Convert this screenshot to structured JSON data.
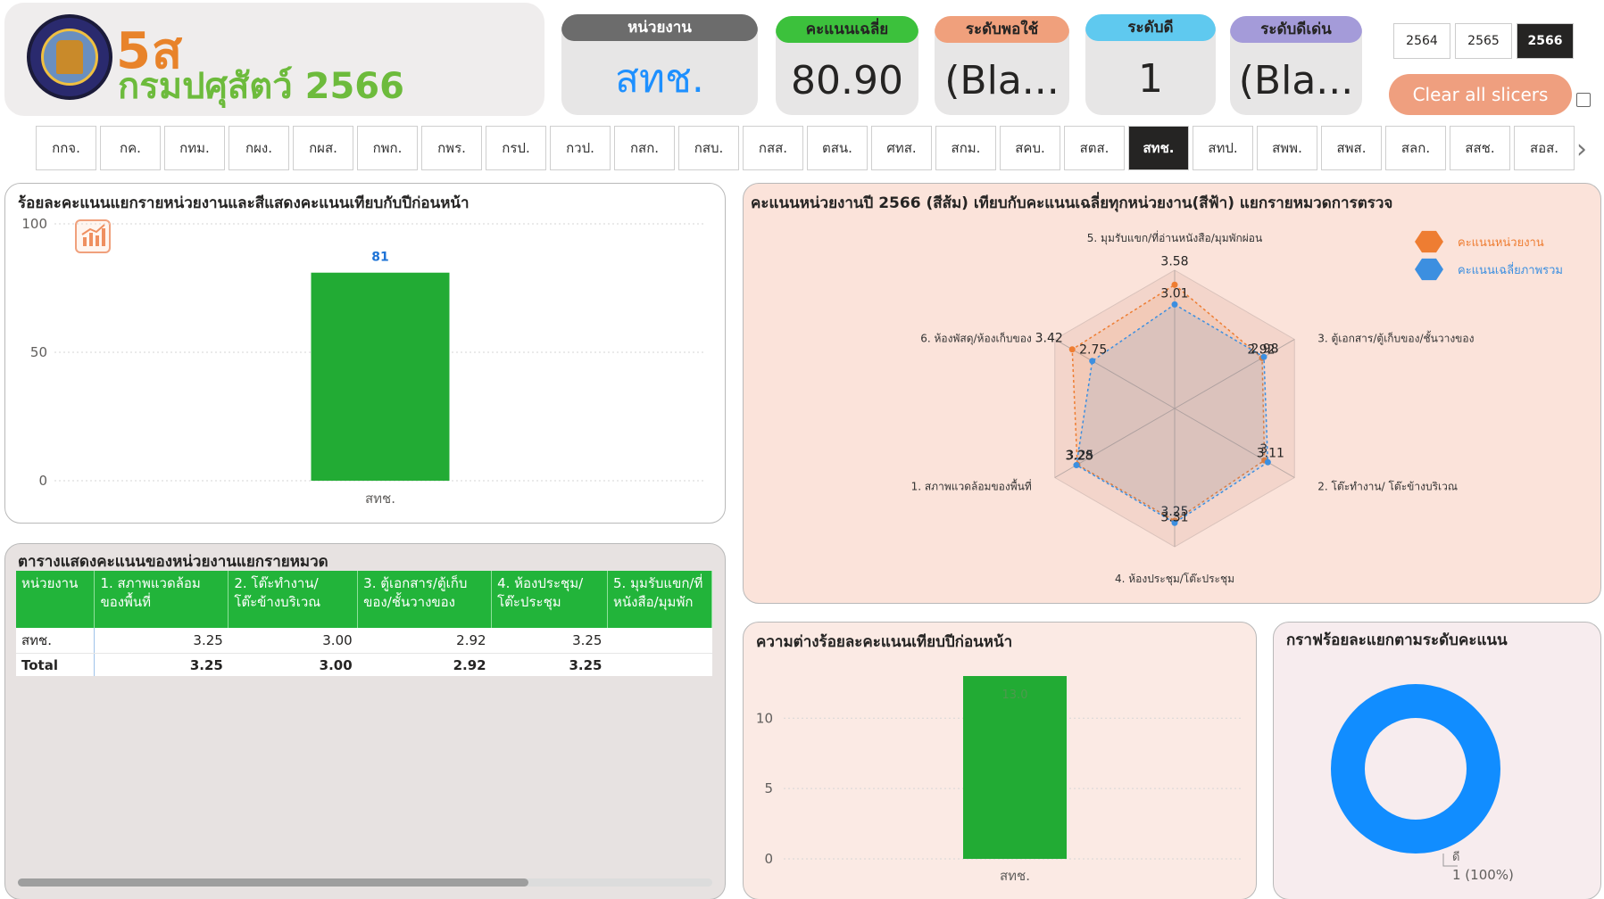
{
  "header": {
    "logo_line1": "5ส",
    "logo_line2": "กรมปศุสัตว์ 2566"
  },
  "cards": [
    {
      "label": "หน่วยงาน",
      "value": "สทช.",
      "head_color": "#6c6c6c",
      "value_color": "#1e90ff"
    },
    {
      "label": "คะแนนเฉลี่ย",
      "value": "80.90",
      "head_color": "#3cc13c",
      "value_color": "#252423"
    },
    {
      "label": "ระดับพอใช้",
      "value": "(Bla...",
      "head_color": "#f0a07c",
      "value_color": "#252423"
    },
    {
      "label": "ระดับดี",
      "value": "1",
      "head_color": "#5fc9ef",
      "value_color": "#252423"
    },
    {
      "label": "ระดับดีเด่น",
      "value": "(Bla...",
      "head_color": "#a49bd9",
      "value_color": "#252423"
    }
  ],
  "years": [
    {
      "label": "2564",
      "selected": false
    },
    {
      "label": "2565",
      "selected": false
    },
    {
      "label": "2566",
      "selected": true
    }
  ],
  "clear_label": "Clear all slicers",
  "units": [
    "กกจ.",
    "กค.",
    "กทม.",
    "กผง.",
    "กผส.",
    "กพก.",
    "กพร.",
    "กรป.",
    "กวป.",
    "กสก.",
    "กสบ.",
    "กสส.",
    "ตสน.",
    "ศทส.",
    "สกม.",
    "สคบ.",
    "สตส.",
    "สทช.",
    "สทป.",
    "สพพ.",
    "สพส.",
    "สลก.",
    "สสช.",
    "สอส."
  ],
  "selected_unit": "สทช.",
  "bar_panel": {
    "title": "ร้อยละคะแนนแยกรายหน่วยงานและสีแสดงคะแนนเทียบกับปีก่อนหน้า",
    "chart_data": {
      "type": "bar",
      "categories": [
        "สทช."
      ],
      "values": [
        81
      ],
      "ylim": [
        0,
        100
      ],
      "yticks": [
        0,
        50,
        100
      ],
      "data_labels": [
        "81"
      ],
      "bar_color": "#22ab34",
      "label_color": "#1e73d6"
    }
  },
  "radar_panel": {
    "title": "คะแนนหน่วยงานปี 2566 (สีส้ม) เทียบกับคะแนนเฉลี่ยทุกหน่วยงาน(สีฟ้า) แยกรายหมวดการตรวจ",
    "chart_data": {
      "type": "radar",
      "axes": [
        "5. มุมรับแขก/ที่อ่านหนังสือ/มุมพักผ่อน",
        "3. ตู้เอกสาร/ตู้เก็บของ/ชั้นวางของ",
        "2. โต๊ะทำงาน/ โต๊ะข้างบริเวณ",
        "4. ห้องประชุม/โต๊ะประชุม",
        "1. สภาพแวดล้อมของพื้นที่",
        "6. ห้องพัสดุ/ห้องเก็บของ"
      ],
      "rmax": 4,
      "series": [
        {
          "name": "คะแนนหน่วยงาน",
          "color": "#ee7d32",
          "values": [
            3.58,
            2.92,
            3.0,
            3.25,
            3.25,
            3.42
          ],
          "labels": [
            "3.58",
            "2.92",
            "3",
            "3.25",
            "3.25",
            "3.42"
          ]
        },
        {
          "name": "คะแนนเฉลี่ยภาพรวม",
          "color": "#3c8fe0",
          "values": [
            3.01,
            2.98,
            3.11,
            3.31,
            3.28,
            2.75
          ],
          "labels": [
            "3.01",
            "2.98",
            "3.11",
            "3.31",
            "3.28",
            "2.75"
          ]
        }
      ]
    }
  },
  "table_panel": {
    "title": "ตารางแสดงคะแนนของหน่วยงานแยกรายหมวด",
    "columns": [
      {
        "l1": "หน่วยงาน",
        "l2": ""
      },
      {
        "l1": "1. สภาพแวดล้อม",
        "l2": "ของพื้นที่"
      },
      {
        "l1": "2. โต๊ะทำงาน/",
        "l2": "โต๊ะข้างบริเวณ"
      },
      {
        "l1": "3. ตู้เอกสาร/ตู้เก็บ",
        "l2": "ของ/ชั้นวางของ"
      },
      {
        "l1": "4. ห้องประชุม/",
        "l2": "โต๊ะประชุม"
      },
      {
        "l1": "5. มุมรับแขก/ที่",
        "l2": "หนังสือ/มุมพัก"
      }
    ],
    "rows": [
      {
        "name": "สทช.",
        "values": [
          "3.25",
          "3.00",
          "2.92",
          "3.25",
          ""
        ]
      }
    ],
    "total": {
      "name": "Total",
      "values": [
        "3.25",
        "3.00",
        "2.92",
        "3.25",
        ""
      ]
    }
  },
  "diff_panel": {
    "title": "ความต่างร้อยละคะแนนเทียบปีก่อนหน้า",
    "chart_data": {
      "type": "bar",
      "categories": [
        "สทช."
      ],
      "values": [
        13.0
      ],
      "ylim": [
        0,
        13
      ],
      "yticks": [
        0,
        5,
        10
      ],
      "data_labels": [
        "13.0"
      ],
      "bar_color": "#22ab34"
    }
  },
  "donut_panel": {
    "title": "กราฟร้อยละแยกตามระดับคะแนน",
    "chart_data": {
      "type": "pie",
      "slices": [
        {
          "label": "ดี",
          "value": 1,
          "percent_label": "1 (100%)",
          "color": "#118dff"
        }
      ]
    }
  }
}
